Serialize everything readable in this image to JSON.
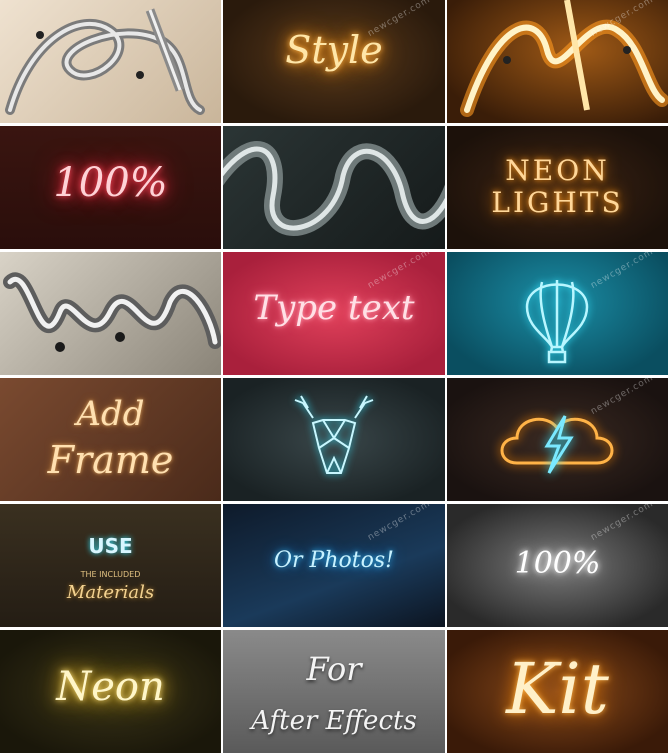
{
  "watermark": "newcger.com",
  "tiles": {
    "t2": {
      "text": "Style"
    },
    "t4": {
      "text": "100%"
    },
    "t6": {
      "line1": "NEON",
      "line2": "LIGHTS"
    },
    "t8": {
      "text": "Type text"
    },
    "t10": {
      "line1": "Add",
      "line2": "Frame"
    },
    "t13": {
      "line1": "USE",
      "line2": "THE INCLUDED",
      "line3": "Materials"
    },
    "t14": {
      "text": "Or Photos!"
    },
    "t15": {
      "text": "100%"
    },
    "t16": {
      "text": "Neon"
    },
    "t17": {
      "line1": "For",
      "line2": "After Effects"
    },
    "t18": {
      "text": "Kit"
    }
  },
  "colors": {
    "warm_orange": "#ffb347",
    "neon_red": "#ff4d5e",
    "neon_cyan": "#35e6ff",
    "neon_yellow": "#ffe27a"
  }
}
